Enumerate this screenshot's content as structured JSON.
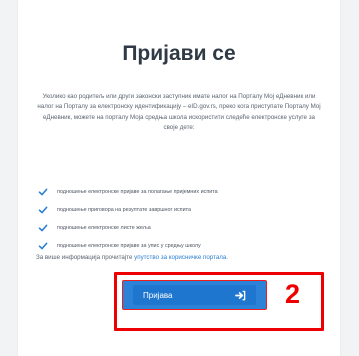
{
  "page": {
    "title": "Пријави се",
    "intro": "Уколико као родитељ или други законски заступник имате налог на Порталу Мој еДневник или налог на Порталу за електронску идентификацију – eID.gov.rs, преко кога приступате Порталу Мој еДневник, можете на порталу Моја средња школа искористити следеће електронске услуге за своје дете:",
    "services": [
      "подношење електронске пријаве за полагање пријемних испита",
      "подношење приговора на резултате завршног испита",
      "подношење електронске листе жеља",
      "подношење електронске пријаве за упис у средњу школу"
    ],
    "footer_text": "За више информација прочитајте ",
    "footer_link": "упутство за корисничке портала.",
    "login_label": "Пријава",
    "step_number": "2"
  },
  "colors": {
    "accent": "#1f76cf",
    "check": "#2a7fd3",
    "highlight": "#ee0000"
  }
}
